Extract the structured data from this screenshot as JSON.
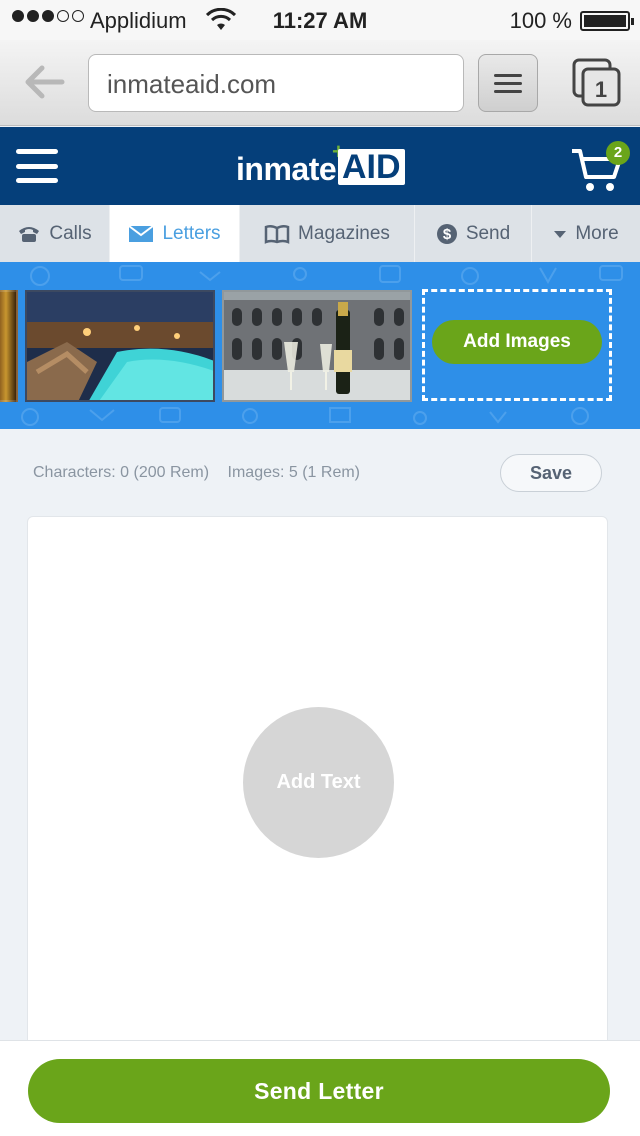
{
  "status_bar": {
    "carrier": "Applidium",
    "time": "11:27 AM",
    "battery": "100 %",
    "signal_bars_filled": 3,
    "signal_bars_total": 5
  },
  "browser": {
    "url": "inmateaid.com",
    "tab_count": "1"
  },
  "header": {
    "logo_part1": "inmate",
    "logo_part2": "AID",
    "cart_count": "2",
    "brand_color": "#053f7a",
    "accent_green": "#6aa51a"
  },
  "tabs": [
    {
      "label": "Calls",
      "icon": "phone-icon",
      "active": false
    },
    {
      "label": "Letters",
      "icon": "envelope-icon",
      "active": true
    },
    {
      "label": "Magazines",
      "icon": "open-book-icon",
      "active": false
    },
    {
      "label": "Send",
      "icon": "dollar-icon",
      "active": false
    },
    {
      "label": "More",
      "icon": "caret-down-icon",
      "active": false
    }
  ],
  "banner": {
    "add_images_label": "Add Images"
  },
  "counters": {
    "characters": "Characters: 0 (200 Rem)",
    "images": "Images: 5 (1 Rem)"
  },
  "save_label": "Save",
  "add_text_label": "Add Text",
  "send_label": "Send Letter"
}
